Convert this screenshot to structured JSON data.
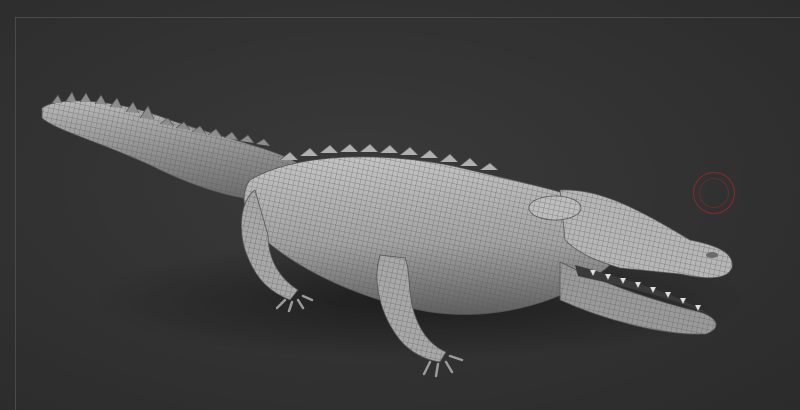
{
  "viewport": {
    "background_color": "#333333",
    "model": {
      "subject": "crocodile",
      "material_color": "#9c9c9c",
      "wire_color": "#4a4a4a",
      "shading": "wireframe-over-matcap"
    },
    "brush_cursor": {
      "color": "#8a2a2a",
      "icon": "brush-circle-icon"
    }
  }
}
